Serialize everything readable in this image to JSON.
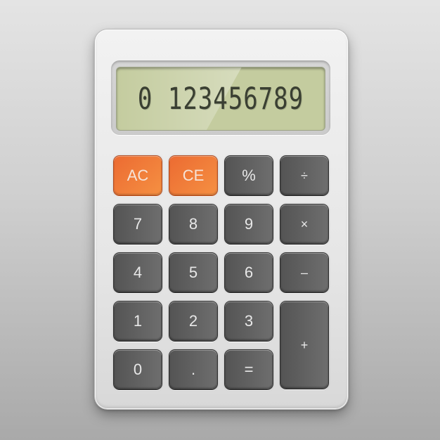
{
  "display": {
    "value": "0 123456789"
  },
  "keys": [
    {
      "id": "ac",
      "label": "AC",
      "style": "orange"
    },
    {
      "id": "ce",
      "label": "CE",
      "style": "orange"
    },
    {
      "id": "percent",
      "label": "%",
      "style": "dark"
    },
    {
      "id": "divide",
      "label": "÷",
      "style": "dark"
    },
    {
      "id": "seven",
      "label": "7",
      "style": "dark"
    },
    {
      "id": "eight",
      "label": "8",
      "style": "dark"
    },
    {
      "id": "nine",
      "label": "9",
      "style": "dark"
    },
    {
      "id": "multiply",
      "label": "×",
      "style": "dark"
    },
    {
      "id": "four",
      "label": "4",
      "style": "dark"
    },
    {
      "id": "five",
      "label": "5",
      "style": "dark"
    },
    {
      "id": "six",
      "label": "6",
      "style": "dark"
    },
    {
      "id": "minus",
      "label": "–",
      "style": "dark"
    },
    {
      "id": "one",
      "label": "1",
      "style": "dark"
    },
    {
      "id": "two",
      "label": "2",
      "style": "dark"
    },
    {
      "id": "three",
      "label": "3",
      "style": "dark"
    },
    {
      "id": "plus",
      "label": "+",
      "style": "dark"
    },
    {
      "id": "zero",
      "label": "0",
      "style": "dark"
    },
    {
      "id": "decimal",
      "label": ".",
      "style": "dark"
    },
    {
      "id": "equals",
      "label": "=",
      "style": "dark"
    }
  ],
  "colors": {
    "accent_key": "#f07a37",
    "dark_key": "#606060",
    "lcd": "#c4cc9f",
    "lcd_text": "#3a3f32",
    "body": "#ececec"
  }
}
